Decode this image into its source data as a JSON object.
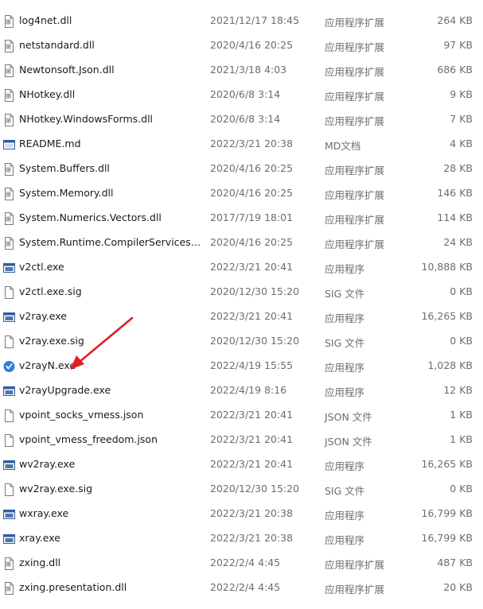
{
  "files": [
    {
      "name": "log4net.dll",
      "date": "2021/12/17 18:45",
      "type": "应用程序扩展",
      "size": "264 KB",
      "icon": "dll-file-icon"
    },
    {
      "name": "netstandard.dll",
      "date": "2020/4/16 20:25",
      "type": "应用程序扩展",
      "size": "97 KB",
      "icon": "dll-file-icon"
    },
    {
      "name": "Newtonsoft.Json.dll",
      "date": "2021/3/18 4:03",
      "type": "应用程序扩展",
      "size": "686 KB",
      "icon": "dll-file-icon"
    },
    {
      "name": "NHotkey.dll",
      "date": "2020/6/8 3:14",
      "type": "应用程序扩展",
      "size": "9 KB",
      "icon": "dll-file-icon"
    },
    {
      "name": "NHotkey.WindowsForms.dll",
      "date": "2020/6/8 3:14",
      "type": "应用程序扩展",
      "size": "7 KB",
      "icon": "dll-file-icon"
    },
    {
      "name": "README.md",
      "date": "2022/3/21 20:38",
      "type": "MD文档",
      "size": "4 KB",
      "icon": "md-file-icon"
    },
    {
      "name": "System.Buffers.dll",
      "date": "2020/4/16 20:25",
      "type": "应用程序扩展",
      "size": "28 KB",
      "icon": "dll-file-icon"
    },
    {
      "name": "System.Memory.dll",
      "date": "2020/4/16 20:25",
      "type": "应用程序扩展",
      "size": "146 KB",
      "icon": "dll-file-icon"
    },
    {
      "name": "System.Numerics.Vectors.dll",
      "date": "2017/7/19 18:01",
      "type": "应用程序扩展",
      "size": "114 KB",
      "icon": "dll-file-icon"
    },
    {
      "name": "System.Runtime.CompilerServices.Un...",
      "date": "2020/4/16 20:25",
      "type": "应用程序扩展",
      "size": "24 KB",
      "icon": "dll-file-icon"
    },
    {
      "name": "v2ctl.exe",
      "date": "2022/3/21 20:41",
      "type": "应用程序",
      "size": "10,888 KB",
      "icon": "exe-file-icon"
    },
    {
      "name": "v2ctl.exe.sig",
      "date": "2020/12/30 15:20",
      "type": "SIG 文件",
      "size": "0 KB",
      "icon": "blank-file-icon"
    },
    {
      "name": "v2ray.exe",
      "date": "2022/3/21 20:41",
      "type": "应用程序",
      "size": "16,265 KB",
      "icon": "exe-file-icon"
    },
    {
      "name": "v2ray.exe.sig",
      "date": "2020/12/30 15:20",
      "type": "SIG 文件",
      "size": "0 KB",
      "icon": "blank-file-icon"
    },
    {
      "name": "v2rayN.exe",
      "date": "2022/4/19 15:55",
      "type": "应用程序",
      "size": "1,028 KB",
      "icon": "v2rayn-app-icon"
    },
    {
      "name": "v2rayUpgrade.exe",
      "date": "2022/4/19 8:16",
      "type": "应用程序",
      "size": "12 KB",
      "icon": "exe-file-icon"
    },
    {
      "name": "vpoint_socks_vmess.json",
      "date": "2022/3/21 20:41",
      "type": "JSON 文件",
      "size": "1 KB",
      "icon": "blank-file-icon"
    },
    {
      "name": "vpoint_vmess_freedom.json",
      "date": "2022/3/21 20:41",
      "type": "JSON 文件",
      "size": "1 KB",
      "icon": "blank-file-icon"
    },
    {
      "name": "wv2ray.exe",
      "date": "2022/3/21 20:41",
      "type": "应用程序",
      "size": "16,265 KB",
      "icon": "exe-file-icon"
    },
    {
      "name": "wv2ray.exe.sig",
      "date": "2020/12/30 15:20",
      "type": "SIG 文件",
      "size": "0 KB",
      "icon": "blank-file-icon"
    },
    {
      "name": "wxray.exe",
      "date": "2022/3/21 20:38",
      "type": "应用程序",
      "size": "16,799 KB",
      "icon": "exe-file-icon"
    },
    {
      "name": "xray.exe",
      "date": "2022/3/21 20:38",
      "type": "应用程序",
      "size": "16,799 KB",
      "icon": "exe-file-icon"
    },
    {
      "name": "zxing.dll",
      "date": "2022/2/4 4:45",
      "type": "应用程序扩展",
      "size": "487 KB",
      "icon": "dll-file-icon"
    },
    {
      "name": "zxing.presentation.dll",
      "date": "2022/2/4 4:45",
      "type": "应用程序扩展",
      "size": "20 KB",
      "icon": "dll-file-icon"
    }
  ],
  "annotation": {
    "color": "#e02020",
    "icon": "red-arrow-icon"
  },
  "colors": {
    "exe_icon_blue": "#2f5f9e",
    "v2rayn_icon_blue": "#2f7fd6",
    "meta_text": "#6d6d6d"
  }
}
